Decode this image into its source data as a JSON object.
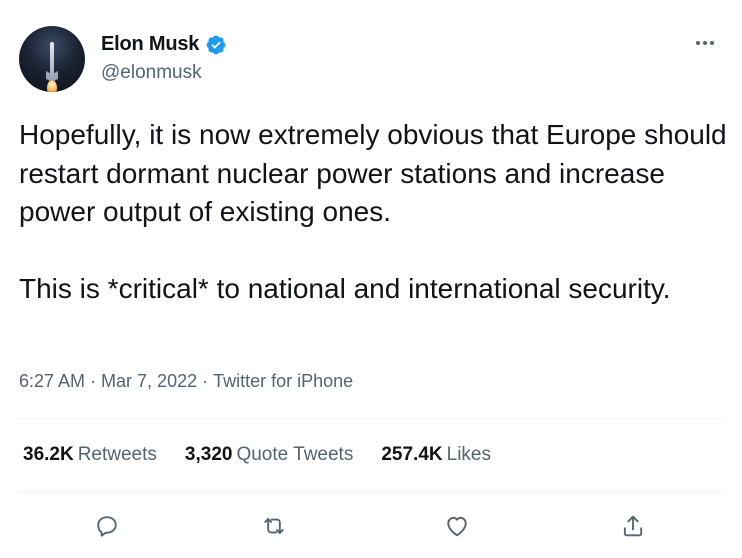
{
  "author": {
    "name": "Elon Musk",
    "handle": "@elonmusk",
    "verified": true
  },
  "tweet": {
    "paragraph_1": "Hopefully, it is now extremely obvious that Europe should restart dormant nuclear power stations and increase power output of existing ones.",
    "paragraph_2": "This is *critical* to national and international security."
  },
  "meta": {
    "time": "6:27 AM",
    "separator": "·",
    "date": "Mar 7, 2022",
    "source": "Twitter for iPhone"
  },
  "stats": {
    "retweets_count": "36.2K",
    "retweets_label": "Retweets",
    "quotes_count": "3,320",
    "quotes_label": "Quote Tweets",
    "likes_count": "257.4K",
    "likes_label": "Likes"
  },
  "icons": {
    "more": "more-horizontal-icon",
    "reply": "reply-icon",
    "retweet": "retweet-icon",
    "like": "heart-icon",
    "share": "share-icon",
    "verified": "verified-badge-icon"
  },
  "colors": {
    "primary_text": "#0f1419",
    "secondary_text": "#536471",
    "verified_blue": "#1d9bf0",
    "divider": "#eff3f4"
  }
}
